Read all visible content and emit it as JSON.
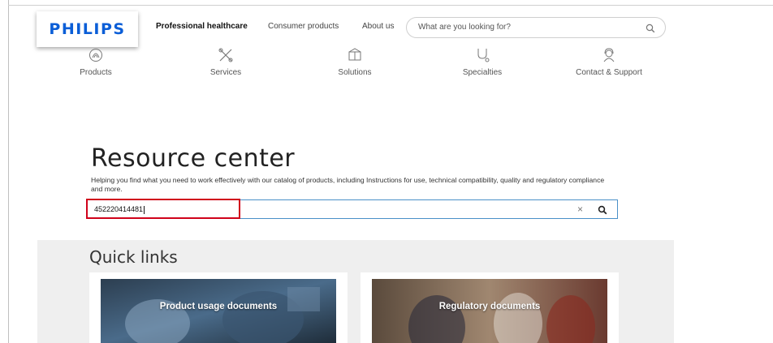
{
  "header": {
    "logo_text": "PHILIPS",
    "nav": [
      {
        "label": "Professional healthcare",
        "active": true
      },
      {
        "label": "Consumer products",
        "active": false
      },
      {
        "label": "About us",
        "active": false
      }
    ],
    "search_placeholder": "What are you looking for?"
  },
  "categories": [
    {
      "label": "Products",
      "icon": "products-icon"
    },
    {
      "label": "Services",
      "icon": "services-icon"
    },
    {
      "label": "Solutions",
      "icon": "solutions-icon"
    },
    {
      "label": "Specialties",
      "icon": "stethoscope-icon"
    },
    {
      "label": "Contact & Support",
      "icon": "support-agent-icon"
    }
  ],
  "hero": {
    "title": "Resource center",
    "description": "Helping you find what you need to work effectively with our catalog of products, including Instructions for use, technical compatibility, quality and regulatory compliance and more.",
    "search_value": "452220414481"
  },
  "quick_links": {
    "title": "Quick links",
    "cards": [
      {
        "label": "Product usage documents"
      },
      {
        "label": "Regulatory documents"
      }
    ]
  },
  "colors": {
    "brand": "#0b5ed7",
    "highlight": "#d0021b",
    "input_border": "#4a90c8"
  }
}
